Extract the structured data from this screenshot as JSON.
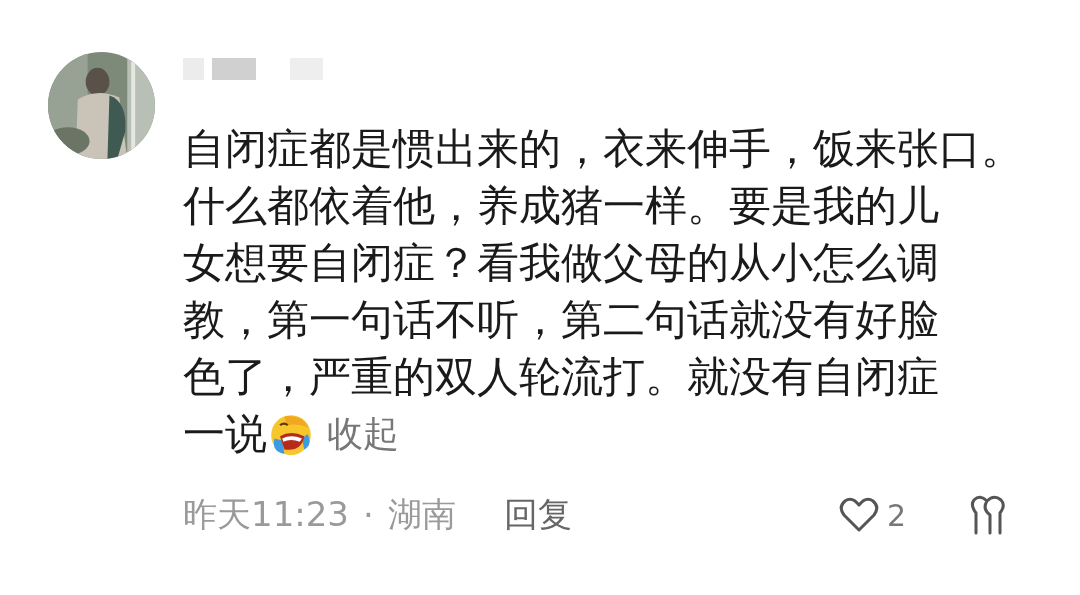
{
  "comment": {
    "lines": [
      "自闭症都是惯出来的，衣来伸手，饭来张口。",
      "什么都依着他，养成猪一样。要是我的儿",
      "女想要自闭症？看我做父母的从小怎么调",
      "教，第一句话不听，第二句话就没有好脸",
      "色了，严重的双人轮流打。就没有自闭症",
      "一说"
    ],
    "collapse": "收起",
    "time": "昨天11:23",
    "separator": "·",
    "location": "湖南",
    "reply": "回复",
    "likes": "2"
  }
}
